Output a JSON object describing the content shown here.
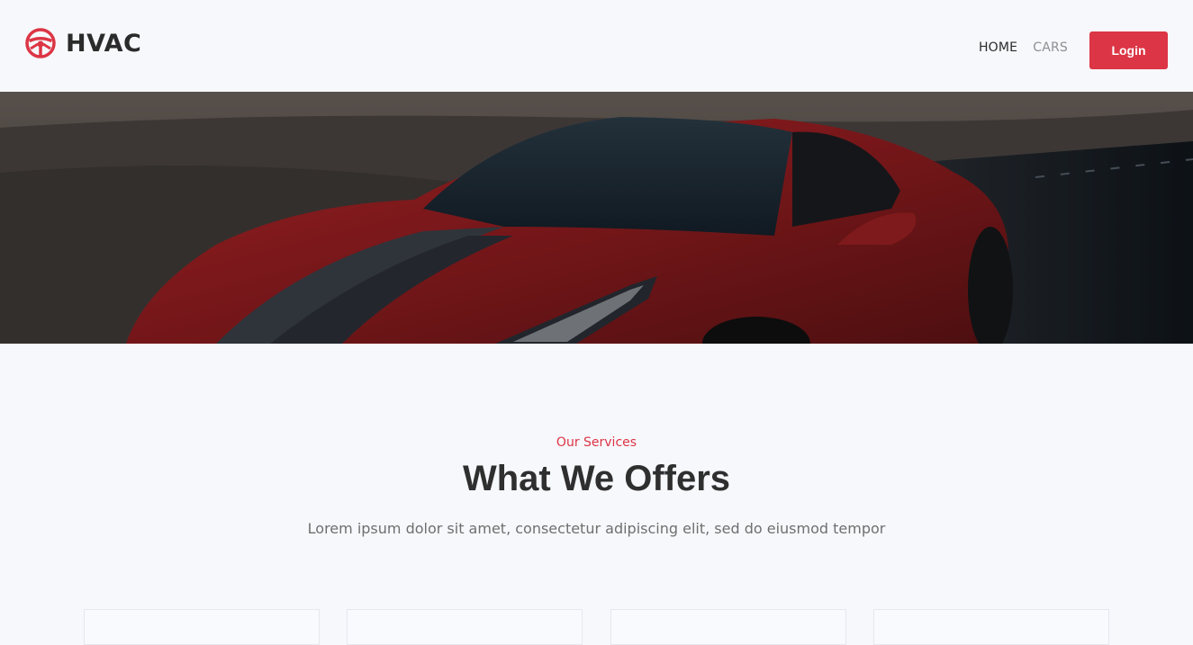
{
  "brand": {
    "name": "HVAC",
    "icon": "steering-wheel-icon",
    "accent_color": "#dc3545"
  },
  "nav": {
    "items": [
      {
        "label": "HOME",
        "active": true
      },
      {
        "label": "CARS",
        "active": false
      }
    ],
    "login_label": "Login"
  },
  "hero": {
    "image": "red-convertible-sports-car"
  },
  "services": {
    "eyebrow": "Our Services",
    "title": "What We Offers",
    "subtitle": "Lorem ipsum dolor sit amet, consectetur adipiscing elit, sed do eiusmod tempor"
  }
}
